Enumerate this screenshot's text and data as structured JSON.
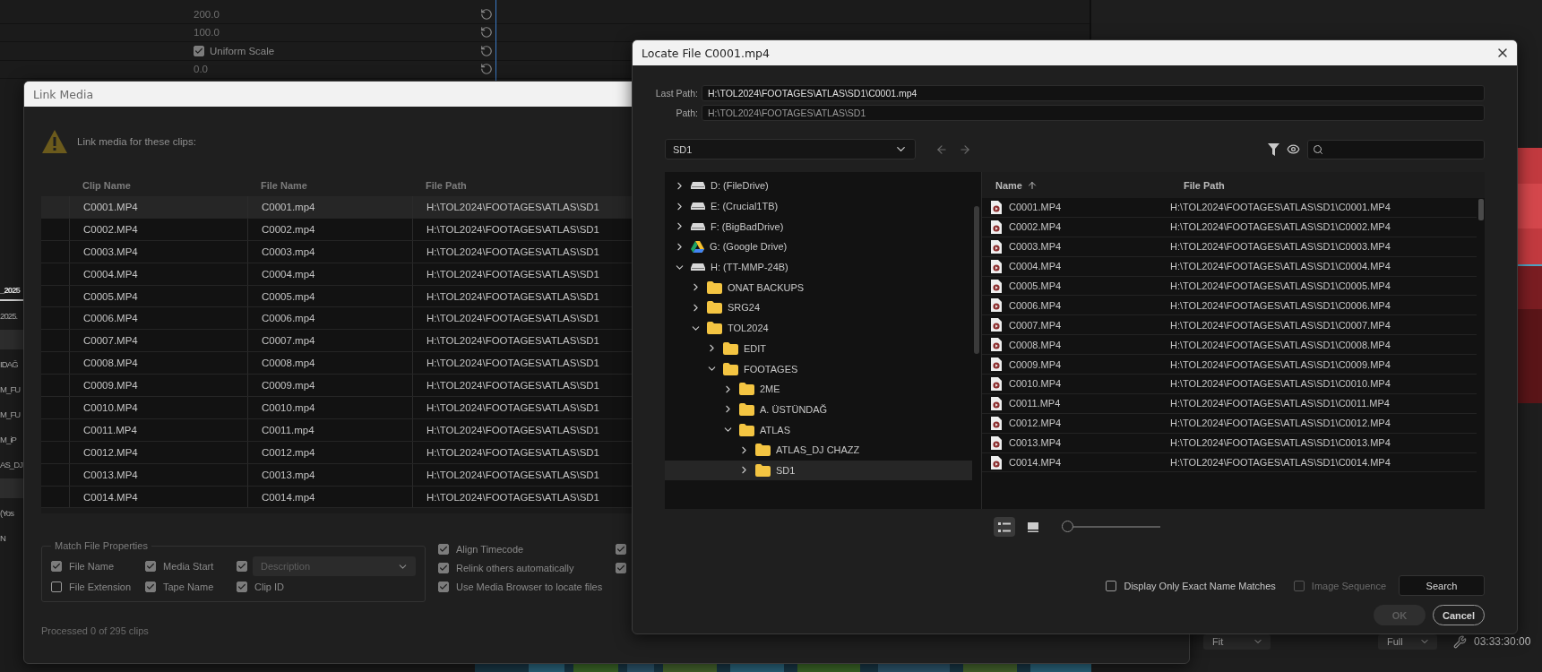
{
  "background": {
    "properties": [
      {
        "kind": "value",
        "text": "200.0"
      },
      {
        "kind": "value",
        "text": "100.0"
      },
      {
        "kind": "checkbox",
        "text": "Uniform Scale",
        "checked": true
      },
      {
        "kind": "value",
        "text": "0.0"
      }
    ],
    "fragments": [
      {
        "kind": "tab",
        "text": "_2025"
      },
      {
        "kind": "item",
        "text": "2025."
      },
      {
        "kind": "band"
      },
      {
        "kind": "item",
        "text": "IDAĞ"
      },
      {
        "kind": "item",
        "text": "M_FU"
      },
      {
        "kind": "item",
        "text": "M_FU"
      },
      {
        "kind": "item",
        "text": "M_iP"
      },
      {
        "kind": "item",
        "text": "AS_DJ"
      },
      {
        "kind": "band"
      },
      {
        "kind": "item",
        "text": "(Yos"
      },
      {
        "kind": "item",
        "text": "N"
      }
    ],
    "monitor": {
      "zoom": "Fit",
      "quality": "Full",
      "timecode": "03:33:30:00"
    }
  },
  "link_media": {
    "title": "Link Media",
    "message": "Link media for these clips:",
    "columns": [
      "Clip Name",
      "File Name",
      "File Path"
    ],
    "rows": [
      {
        "clip": "C0001.MP4",
        "file": "C0001.mp4",
        "path": "H:\\TOL2024\\FOOTAGES\\ATLAS\\SD1",
        "selected": true
      },
      {
        "clip": "C0002.MP4",
        "file": "C0002.mp4",
        "path": "H:\\TOL2024\\FOOTAGES\\ATLAS\\SD1",
        "selected": false
      },
      {
        "clip": "C0003.MP4",
        "file": "C0003.mp4",
        "path": "H:\\TOL2024\\FOOTAGES\\ATLAS\\SD1",
        "selected": false
      },
      {
        "clip": "C0004.MP4",
        "file": "C0004.mp4",
        "path": "H:\\TOL2024\\FOOTAGES\\ATLAS\\SD1",
        "selected": false
      },
      {
        "clip": "C0005.MP4",
        "file": "C0005.mp4",
        "path": "H:\\TOL2024\\FOOTAGES\\ATLAS\\SD1",
        "selected": false
      },
      {
        "clip": "C0006.MP4",
        "file": "C0006.mp4",
        "path": "H:\\TOL2024\\FOOTAGES\\ATLAS\\SD1",
        "selected": false
      },
      {
        "clip": "C0007.MP4",
        "file": "C0007.mp4",
        "path": "H:\\TOL2024\\FOOTAGES\\ATLAS\\SD1",
        "selected": false
      },
      {
        "clip": "C0008.MP4",
        "file": "C0008.mp4",
        "path": "H:\\TOL2024\\FOOTAGES\\ATLAS\\SD1",
        "selected": false
      },
      {
        "clip": "C0009.MP4",
        "file": "C0009.mp4",
        "path": "H:\\TOL2024\\FOOTAGES\\ATLAS\\SD1",
        "selected": false
      },
      {
        "clip": "C0010.MP4",
        "file": "C0010.mp4",
        "path": "H:\\TOL2024\\FOOTAGES\\ATLAS\\SD1",
        "selected": false
      },
      {
        "clip": "C0011.MP4",
        "file": "C0011.mp4",
        "path": "H:\\TOL2024\\FOOTAGES\\ATLAS\\SD1",
        "selected": false
      },
      {
        "clip": "C0012.MP4",
        "file": "C0012.mp4",
        "path": "H:\\TOL2024\\FOOTAGES\\ATLAS\\SD1",
        "selected": false
      },
      {
        "clip": "C0013.MP4",
        "file": "C0013.mp4",
        "path": "H:\\TOL2024\\FOOTAGES\\ATLAS\\SD1",
        "selected": false
      },
      {
        "clip": "C0014.MP4",
        "file": "C0014.mp4",
        "path": "H:\\TOL2024\\FOOTAGES\\ATLAS\\SD1",
        "selected": false
      }
    ],
    "match_group": {
      "title": "Match File Properties",
      "options": [
        {
          "label": "File Name",
          "checked": true
        },
        {
          "label": "Media Start",
          "checked": true
        },
        {
          "label": "File Extension",
          "checked": false
        },
        {
          "label": "Tape Name",
          "checked": true
        }
      ],
      "description": {
        "checked": true,
        "value": "Description"
      },
      "clip_id": {
        "label": "Clip ID",
        "checked": true
      }
    },
    "options": [
      {
        "label": "Align Timecode",
        "checked": true
      },
      {
        "label": "Relink others automatically",
        "checked": true
      },
      {
        "label": "Use Media Browser to locate files",
        "checked": true
      }
    ],
    "side_checks": [
      {
        "checked": true
      },
      {
        "checked": true
      }
    ],
    "status": "Processed 0 of 295 clips"
  },
  "locate_file": {
    "title": "Locate File C0001.mp4",
    "last_path": {
      "label": "Last Path:",
      "value": "H:\\TOL2024\\FOOTAGES\\ATLAS\\SD1\\C0001.mp4"
    },
    "path": {
      "label": "Path:",
      "value": "H:\\TOL2024\\FOOTAGES\\ATLAS\\SD1"
    },
    "location": "SD1",
    "tree": [
      {
        "label": "D: (FileDrive)",
        "kind": "drive",
        "expanded": false,
        "selected": false
      },
      {
        "label": "E: (Crucial1TB)",
        "kind": "drive",
        "expanded": false,
        "selected": false
      },
      {
        "label": "F: (BigBadDrive)",
        "kind": "drive",
        "expanded": false,
        "selected": false
      },
      {
        "label": "G: (Google Drive)",
        "kind": "cloud",
        "expanded": false,
        "selected": false
      },
      {
        "label": "H: (TT-MMP-24B)",
        "kind": "drive",
        "expanded": true,
        "selected": false,
        "children": [
          {
            "label": "ONAT BACKUPS",
            "kind": "folder",
            "expanded": false,
            "selected": false
          },
          {
            "label": "SRG24",
            "kind": "folder",
            "expanded": false,
            "selected": false
          },
          {
            "label": "TOL2024",
            "kind": "folder",
            "expanded": true,
            "selected": false,
            "children": [
              {
                "label": "EDIT",
                "kind": "folder",
                "expanded": false,
                "selected": false
              },
              {
                "label": "FOOTAGES",
                "kind": "folder",
                "expanded": true,
                "selected": false,
                "children": [
                  {
                    "label": "2ME",
                    "kind": "folder",
                    "expanded": false,
                    "selected": false
                  },
                  {
                    "label": "A. ÜSTÜNDAĞ",
                    "kind": "folder",
                    "expanded": false,
                    "selected": false
                  },
                  {
                    "label": "ATLAS",
                    "kind": "folder",
                    "expanded": true,
                    "selected": false,
                    "children": [
                      {
                        "label": "ATLAS_DJ CHAZZ",
                        "kind": "folder",
                        "expanded": false,
                        "selected": false
                      },
                      {
                        "label": "SD1",
                        "kind": "folder",
                        "expanded": false,
                        "selected": true
                      }
                    ]
                  }
                ]
              }
            ]
          }
        ]
      }
    ],
    "columns": [
      {
        "label": "Name",
        "sorted": true
      },
      {
        "label": "File Path",
        "sorted": false
      }
    ],
    "files": [
      {
        "name": "C0001.MP4",
        "path": "H:\\TOL2024\\FOOTAGES\\ATLAS\\SD1\\C0001.MP4"
      },
      {
        "name": "C0002.MP4",
        "path": "H:\\TOL2024\\FOOTAGES\\ATLAS\\SD1\\C0002.MP4"
      },
      {
        "name": "C0003.MP4",
        "path": "H:\\TOL2024\\FOOTAGES\\ATLAS\\SD1\\C0003.MP4"
      },
      {
        "name": "C0004.MP4",
        "path": "H:\\TOL2024\\FOOTAGES\\ATLAS\\SD1\\C0004.MP4"
      },
      {
        "name": "C0005.MP4",
        "path": "H:\\TOL2024\\FOOTAGES\\ATLAS\\SD1\\C0005.MP4"
      },
      {
        "name": "C0006.MP4",
        "path": "H:\\TOL2024\\FOOTAGES\\ATLAS\\SD1\\C0006.MP4"
      },
      {
        "name": "C0007.MP4",
        "path": "H:\\TOL2024\\FOOTAGES\\ATLAS\\SD1\\C0007.MP4"
      },
      {
        "name": "C0008.MP4",
        "path": "H:\\TOL2024\\FOOTAGES\\ATLAS\\SD1\\C0008.MP4"
      },
      {
        "name": "C0009.MP4",
        "path": "H:\\TOL2024\\FOOTAGES\\ATLAS\\SD1\\C0009.MP4"
      },
      {
        "name": "C0010.MP4",
        "path": "H:\\TOL2024\\FOOTAGES\\ATLAS\\SD1\\C0010.MP4"
      },
      {
        "name": "C0011.MP4",
        "path": "H:\\TOL2024\\FOOTAGES\\ATLAS\\SD1\\C0011.MP4"
      },
      {
        "name": "C0012.MP4",
        "path": "H:\\TOL2024\\FOOTAGES\\ATLAS\\SD1\\C0012.MP4"
      },
      {
        "name": "C0013.MP4",
        "path": "H:\\TOL2024\\FOOTAGES\\ATLAS\\SD1\\C0013.MP4"
      },
      {
        "name": "C0014.MP4",
        "path": "H:\\TOL2024\\FOOTAGES\\ATLAS\\SD1\\C0014.MP4"
      }
    ],
    "views": [
      {
        "kind": "list",
        "selected": true
      },
      {
        "kind": "thumbnails",
        "selected": false
      }
    ],
    "zoom": {
      "level": 0
    },
    "checks": [
      {
        "label": "Display Only Exact Name Matches",
        "checked": false,
        "disabled": false
      },
      {
        "label": "Image Sequence",
        "checked": false,
        "disabled": true
      }
    ],
    "buttons": [
      {
        "kind": "search",
        "label": "Search",
        "disabled": false
      },
      {
        "kind": "ok",
        "label": "OK",
        "disabled": true
      },
      {
        "kind": "cancel",
        "label": "Cancel",
        "disabled": false
      }
    ]
  }
}
